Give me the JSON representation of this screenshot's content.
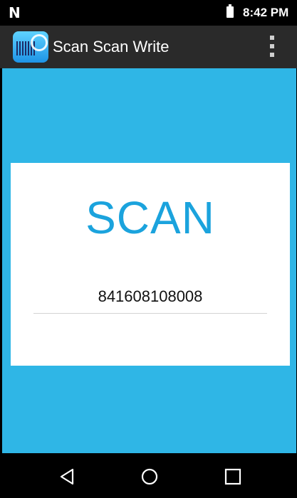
{
  "status_bar": {
    "carrier_mark": "N",
    "time": "8:42 PM",
    "icons": [
      "notification-n-icon",
      "battery-icon"
    ]
  },
  "app_bar": {
    "title": "Scan Scan Write",
    "icon": "barcode-app-icon",
    "menu_icon": "overflow-menu-icon"
  },
  "card": {
    "title": "SCAN",
    "input_value": "841608108008"
  },
  "nav_bar": {
    "icons": [
      "back-icon",
      "home-icon",
      "recents-icon"
    ]
  },
  "colors": {
    "background": "#2fb6e6",
    "accent": "#1ba3dd",
    "app_bar": "#2a2a2a",
    "card": "#ffffff"
  }
}
